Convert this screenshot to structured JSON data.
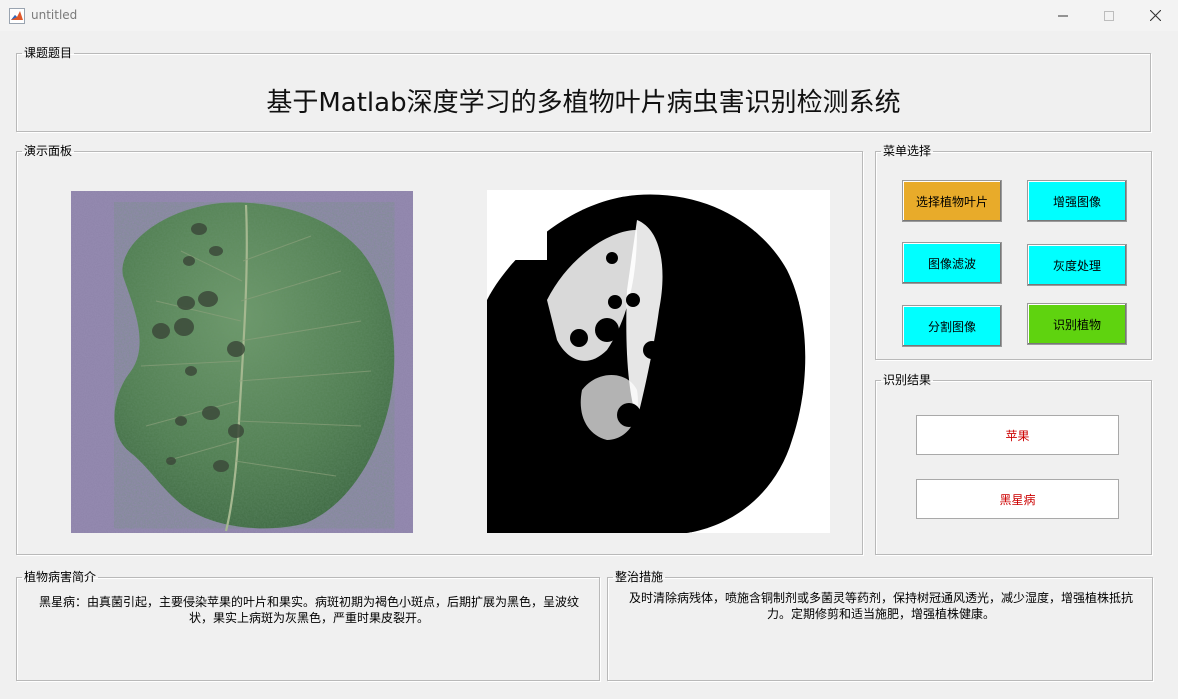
{
  "window": {
    "title": "untitled"
  },
  "topic_panel": {
    "legend": "课题题目",
    "title": "基于Matlab深度学习的多植物叶片病虫害识别检测系统"
  },
  "demo_panel": {
    "legend": "演示面板"
  },
  "menu_panel": {
    "legend": "菜单选择",
    "buttons": {
      "select_leaf": "选择植物叶片",
      "enhance": "增强图像",
      "filter": "图像滤波",
      "grayscale": "灰度处理",
      "segment": "分割图像",
      "identify": "识别植物"
    }
  },
  "result_panel": {
    "legend": "识别结果",
    "plant": "苹果",
    "disease": "黑星病"
  },
  "intro_panel": {
    "legend": "植物病害简介",
    "text": "黑星病：由真菌引起，主要侵染苹果的叶片和果实。病斑初期为褐色小斑点，后期扩展为黑色，呈波纹状，果实上病斑为灰黑色，严重时果皮裂开。"
  },
  "measures_panel": {
    "legend": "整治措施",
    "text": "及时清除病残体，喷施含铜制剂或多菌灵等药剂，保持树冠通风透光，减少湿度，增强植株抵抗力。定期修剪和适当施肥，增强植株健康。"
  },
  "colors": {
    "orange_button": "#e8ab2a",
    "cyan_button": "#00ffff",
    "green_button": "#5fd30f",
    "result_text": "#cc0000"
  }
}
